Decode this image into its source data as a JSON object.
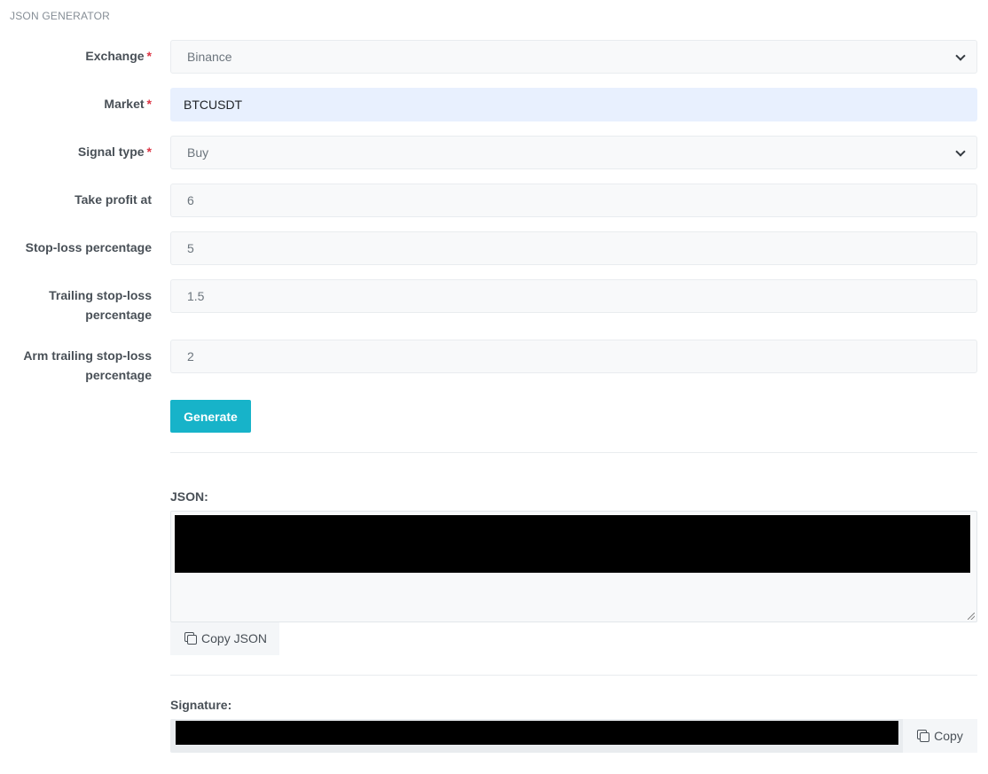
{
  "section_title": "JSON GENERATOR",
  "form": {
    "exchange": {
      "label": "Exchange",
      "required_mark": "*",
      "value": "Binance"
    },
    "market": {
      "label": "Market",
      "required_mark": "*",
      "value": "BTCUSDT"
    },
    "signal_type": {
      "label": "Signal type",
      "required_mark": "*",
      "value": "Buy"
    },
    "take_profit": {
      "label": "Take profit at",
      "value": "6"
    },
    "stop_loss": {
      "label": "Stop-loss percentage",
      "value": "5"
    },
    "trailing_stop_loss": {
      "label_line1": "Trailing stop-loss",
      "label_line2": "percentage",
      "value": "1.5"
    },
    "arm_trailing_stop_loss": {
      "label_line1": "Arm trailing stop-loss",
      "label_line2": "percentage",
      "value": "2"
    }
  },
  "generate_button": "Generate",
  "json_block": {
    "label": "JSON:",
    "copy_label": "Copy JSON"
  },
  "signature_block": {
    "label": "Signature:",
    "copy_label": "Copy"
  },
  "colors": {
    "accent": "#17b3c9",
    "required": "#dc3545",
    "autofill": "#e8f0fe"
  },
  "icons": {
    "chevron": "chevron-down-icon",
    "copy": "copy-icon"
  }
}
